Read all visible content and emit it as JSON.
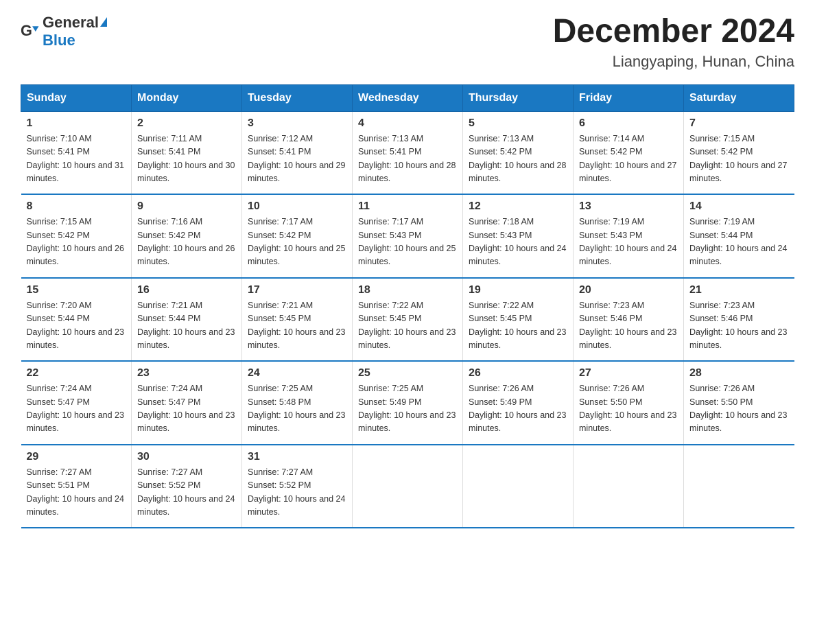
{
  "logo": {
    "text_general": "General",
    "text_blue": "Blue"
  },
  "header": {
    "month_year": "December 2024",
    "location": "Liangyaping, Hunan, China"
  },
  "days_of_week": [
    "Sunday",
    "Monday",
    "Tuesday",
    "Wednesday",
    "Thursday",
    "Friday",
    "Saturday"
  ],
  "weeks": [
    [
      {
        "day": "1",
        "sunrise": "7:10 AM",
        "sunset": "5:41 PM",
        "daylight": "10 hours and 31 minutes."
      },
      {
        "day": "2",
        "sunrise": "7:11 AM",
        "sunset": "5:41 PM",
        "daylight": "10 hours and 30 minutes."
      },
      {
        "day": "3",
        "sunrise": "7:12 AM",
        "sunset": "5:41 PM",
        "daylight": "10 hours and 29 minutes."
      },
      {
        "day": "4",
        "sunrise": "7:13 AM",
        "sunset": "5:41 PM",
        "daylight": "10 hours and 28 minutes."
      },
      {
        "day": "5",
        "sunrise": "7:13 AM",
        "sunset": "5:42 PM",
        "daylight": "10 hours and 28 minutes."
      },
      {
        "day": "6",
        "sunrise": "7:14 AM",
        "sunset": "5:42 PM",
        "daylight": "10 hours and 27 minutes."
      },
      {
        "day": "7",
        "sunrise": "7:15 AM",
        "sunset": "5:42 PM",
        "daylight": "10 hours and 27 minutes."
      }
    ],
    [
      {
        "day": "8",
        "sunrise": "7:15 AM",
        "sunset": "5:42 PM",
        "daylight": "10 hours and 26 minutes."
      },
      {
        "day": "9",
        "sunrise": "7:16 AM",
        "sunset": "5:42 PM",
        "daylight": "10 hours and 26 minutes."
      },
      {
        "day": "10",
        "sunrise": "7:17 AM",
        "sunset": "5:42 PM",
        "daylight": "10 hours and 25 minutes."
      },
      {
        "day": "11",
        "sunrise": "7:17 AM",
        "sunset": "5:43 PM",
        "daylight": "10 hours and 25 minutes."
      },
      {
        "day": "12",
        "sunrise": "7:18 AM",
        "sunset": "5:43 PM",
        "daylight": "10 hours and 24 minutes."
      },
      {
        "day": "13",
        "sunrise": "7:19 AM",
        "sunset": "5:43 PM",
        "daylight": "10 hours and 24 minutes."
      },
      {
        "day": "14",
        "sunrise": "7:19 AM",
        "sunset": "5:44 PM",
        "daylight": "10 hours and 24 minutes."
      }
    ],
    [
      {
        "day": "15",
        "sunrise": "7:20 AM",
        "sunset": "5:44 PM",
        "daylight": "10 hours and 23 minutes."
      },
      {
        "day": "16",
        "sunrise": "7:21 AM",
        "sunset": "5:44 PM",
        "daylight": "10 hours and 23 minutes."
      },
      {
        "day": "17",
        "sunrise": "7:21 AM",
        "sunset": "5:45 PM",
        "daylight": "10 hours and 23 minutes."
      },
      {
        "day": "18",
        "sunrise": "7:22 AM",
        "sunset": "5:45 PM",
        "daylight": "10 hours and 23 minutes."
      },
      {
        "day": "19",
        "sunrise": "7:22 AM",
        "sunset": "5:45 PM",
        "daylight": "10 hours and 23 minutes."
      },
      {
        "day": "20",
        "sunrise": "7:23 AM",
        "sunset": "5:46 PM",
        "daylight": "10 hours and 23 minutes."
      },
      {
        "day": "21",
        "sunrise": "7:23 AM",
        "sunset": "5:46 PM",
        "daylight": "10 hours and 23 minutes."
      }
    ],
    [
      {
        "day": "22",
        "sunrise": "7:24 AM",
        "sunset": "5:47 PM",
        "daylight": "10 hours and 23 minutes."
      },
      {
        "day": "23",
        "sunrise": "7:24 AM",
        "sunset": "5:47 PM",
        "daylight": "10 hours and 23 minutes."
      },
      {
        "day": "24",
        "sunrise": "7:25 AM",
        "sunset": "5:48 PM",
        "daylight": "10 hours and 23 minutes."
      },
      {
        "day": "25",
        "sunrise": "7:25 AM",
        "sunset": "5:49 PM",
        "daylight": "10 hours and 23 minutes."
      },
      {
        "day": "26",
        "sunrise": "7:26 AM",
        "sunset": "5:49 PM",
        "daylight": "10 hours and 23 minutes."
      },
      {
        "day": "27",
        "sunrise": "7:26 AM",
        "sunset": "5:50 PM",
        "daylight": "10 hours and 23 minutes."
      },
      {
        "day": "28",
        "sunrise": "7:26 AM",
        "sunset": "5:50 PM",
        "daylight": "10 hours and 23 minutes."
      }
    ],
    [
      {
        "day": "29",
        "sunrise": "7:27 AM",
        "sunset": "5:51 PM",
        "daylight": "10 hours and 24 minutes."
      },
      {
        "day": "30",
        "sunrise": "7:27 AM",
        "sunset": "5:52 PM",
        "daylight": "10 hours and 24 minutes."
      },
      {
        "day": "31",
        "sunrise": "7:27 AM",
        "sunset": "5:52 PM",
        "daylight": "10 hours and 24 minutes."
      },
      null,
      null,
      null,
      null
    ]
  ],
  "colors": {
    "header_bg": "#1a78c2",
    "border": "#1a78c2"
  }
}
